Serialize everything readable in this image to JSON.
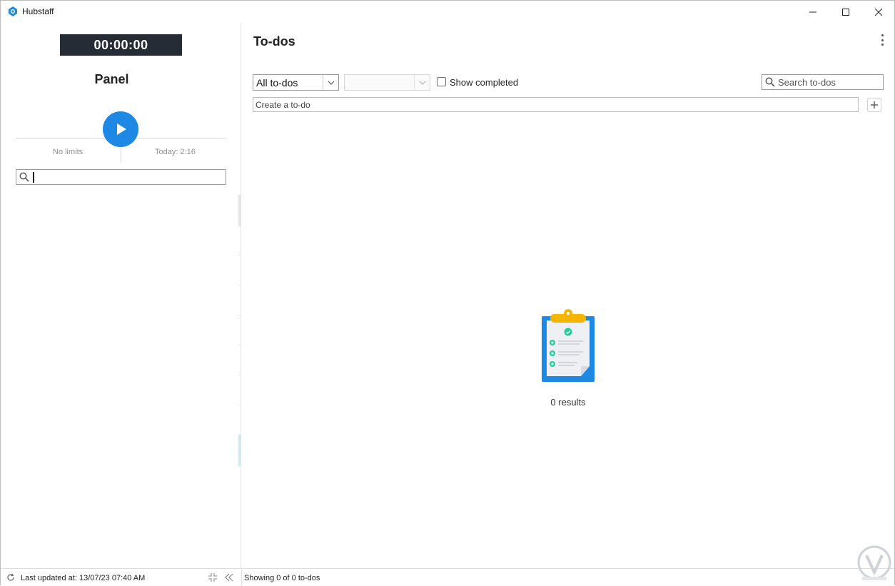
{
  "window": {
    "title": "Hubstaff",
    "controls": [
      "minimize",
      "maximize",
      "close"
    ]
  },
  "left_panel": {
    "timer": "00:00:00",
    "title": "Panel",
    "limits_label": "No limits",
    "today_label": "Today: 2:16",
    "search": {
      "value": "",
      "placeholder": ""
    }
  },
  "main": {
    "title": "To-dos",
    "filter": {
      "selected": "All to-dos"
    },
    "secondary_filter": {
      "selected": ""
    },
    "show_completed": {
      "label": "Show completed",
      "checked": false
    },
    "search": {
      "placeholder": "Search to-dos"
    },
    "create": {
      "placeholder": "Create a to-do"
    },
    "empty_state": {
      "results": "0 results"
    }
  },
  "statusbar": {
    "last_updated": "Last updated at: 13/07/23 07:40 AM",
    "showing": "Showing 0 of 0 to-dos"
  },
  "colors": {
    "accent": "#1e88e5",
    "timer_bg": "#262c35",
    "clipboard_blue": "#1e88e5",
    "clip_yellow": "#f5b400",
    "check_green": "#1fcf9b"
  },
  "icons": [
    "hubstaff-logo-icon",
    "minimize-icon",
    "maximize-icon",
    "close-icon",
    "play-icon",
    "search-icon",
    "chevron-down-icon",
    "kebab-menu-icon",
    "plus-icon",
    "clipboard-icon",
    "refresh-icon",
    "compress-icon",
    "double-chevron-left-icon"
  ]
}
